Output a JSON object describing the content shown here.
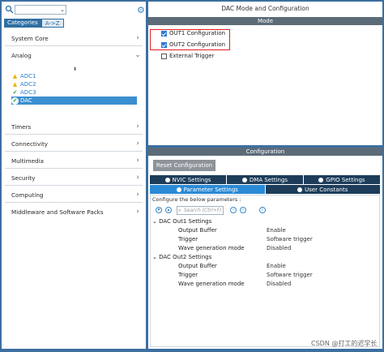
{
  "left": {
    "categories_tab": "Categories",
    "az_tab": "A->Z",
    "sections": [
      {
        "label": "System Core",
        "chevron": "›"
      },
      {
        "label": "Analog",
        "chevron": "⌄"
      },
      {
        "label": "Timers",
        "chevron": "›"
      },
      {
        "label": "Connectivity",
        "chevron": "›"
      },
      {
        "label": "Multimedia",
        "chevron": "›"
      },
      {
        "label": "Security",
        "chevron": "›"
      },
      {
        "label": "Computing",
        "chevron": "›"
      },
      {
        "label": "Middleware and Software Packs",
        "chevron": "›"
      }
    ],
    "analog_items": [
      {
        "label": "ADC1",
        "icon": "warning-icon"
      },
      {
        "label": "ADC2",
        "icon": "warning-icon"
      },
      {
        "label": "ADC3",
        "icon": "check-icon"
      },
      {
        "label": "DAC",
        "icon": "check-circle-icon"
      }
    ]
  },
  "mode": {
    "title": "DAC Mode and Configuration",
    "bar": "Mode",
    "options": [
      {
        "label": "OUT1 Configuration",
        "checked": true
      },
      {
        "label": "OUT2 Configuration",
        "checked": true
      },
      {
        "label": "External Trigger",
        "checked": false
      }
    ]
  },
  "config": {
    "bar": "Configuration",
    "reset_button": "Reset Configuration",
    "tabs_row1": [
      "NVIC Settings",
      "DMA Settings",
      "GPIO Settings"
    ],
    "tabs_row2": [
      "Parameter Settings",
      "User Constants"
    ],
    "hint": "Configure the below parameters :",
    "search_placeholder": "Search (Ctrl+F)",
    "groups": [
      {
        "title": "DAC Out1 Settings",
        "rows": [
          {
            "key": "Output Buffer",
            "value": "Enable"
          },
          {
            "key": "Trigger",
            "value": "Software trigger"
          },
          {
            "key": "Wave generation mode",
            "value": "Disabled"
          }
        ]
      },
      {
        "title": "DAC Out2 Settings",
        "rows": [
          {
            "key": "Output Buffer",
            "value": "Enable"
          },
          {
            "key": "Trigger",
            "value": "Software trigger"
          },
          {
            "key": "Wave generation mode",
            "value": "Disabled"
          }
        ]
      }
    ]
  },
  "watermark": "CSDN @打工的迟学长",
  "colors": {
    "accent": "#2b8ad6",
    "highlight": "#e02020",
    "header_bar": "#5c6b78"
  }
}
